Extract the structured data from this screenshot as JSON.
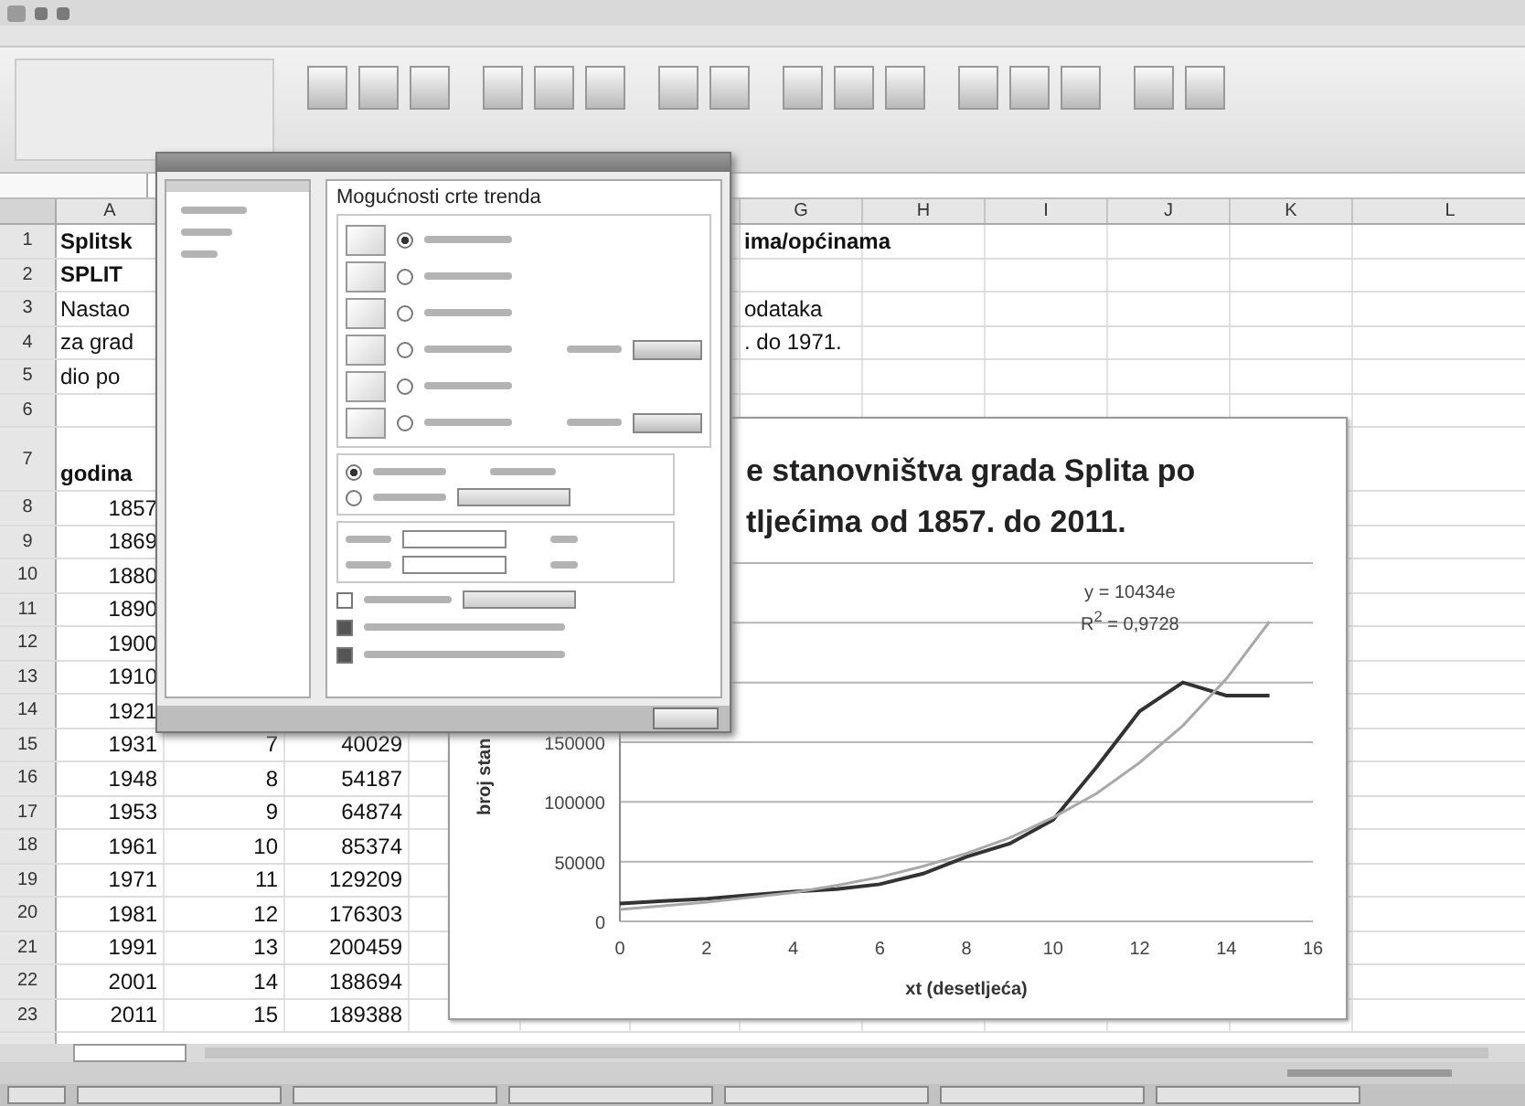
{
  "sheet": {
    "column_headers": [
      "A",
      "G",
      "H",
      "I",
      "J",
      "K",
      "L"
    ],
    "rows": [
      {
        "num": "1",
        "kind": "plain",
        "cells": [
          {
            "text": "Splitsk",
            "bold": true,
            "kind": "text"
          },
          null,
          null,
          null,
          null,
          null,
          {
            "text": "ima/općinama",
            "bold": true,
            "kind": "text"
          }
        ]
      },
      {
        "num": "2",
        "kind": "plain",
        "cells": [
          {
            "text": "SPLIT",
            "bold": true,
            "kind": "text"
          }
        ]
      },
      {
        "num": "3",
        "kind": "plain",
        "cells": [
          {
            "text": "Nastao",
            "bold": false,
            "kind": "text"
          },
          null,
          null,
          null,
          null,
          null,
          {
            "text": "odataka",
            "bold": false,
            "kind": "text"
          }
        ]
      },
      {
        "num": "4",
        "kind": "plain",
        "cells": [
          {
            "text": "za grad",
            "bold": false,
            "kind": "text"
          },
          null,
          null,
          null,
          null,
          null,
          {
            "text": ". do 1971.",
            "bold": false,
            "kind": "text"
          }
        ]
      },
      {
        "num": "5",
        "kind": "plain",
        "cells": [
          {
            "text": "dio po",
            "bold": false,
            "kind": "text"
          }
        ]
      },
      {
        "num": "6",
        "kind": "plain",
        "cells": []
      },
      {
        "num": "7",
        "kind": "tall",
        "cells": [
          {
            "text": "godina",
            "bold": true,
            "kind": "text"
          }
        ]
      },
      {
        "num": "8",
        "kind": "plain",
        "cells": [
          {
            "text": "1857",
            "bold": false,
            "kind": "num"
          }
        ]
      },
      {
        "num": "9",
        "kind": "plain",
        "cells": [
          {
            "text": "1869",
            "bold": false,
            "kind": "num"
          }
        ]
      },
      {
        "num": "10",
        "kind": "plain",
        "cells": [
          {
            "text": "1880",
            "bold": false,
            "kind": "num"
          }
        ]
      },
      {
        "num": "11",
        "kind": "plain",
        "cells": [
          {
            "text": "1890",
            "bold": false,
            "kind": "num"
          }
        ]
      },
      {
        "num": "12",
        "kind": "plain",
        "cells": [
          {
            "text": "1900",
            "bold": false,
            "kind": "num"
          }
        ]
      },
      {
        "num": "13",
        "kind": "plain",
        "cells": [
          {
            "text": "1910",
            "bold": false,
            "kind": "num"
          }
        ]
      },
      {
        "num": "14",
        "kind": "plain",
        "cells": [
          {
            "text": "1921",
            "bold": false,
            "kind": "num"
          }
        ]
      },
      {
        "num": "15",
        "kind": "plain",
        "cells": [
          {
            "text": "1931",
            "bold": false,
            "kind": "num"
          },
          {
            "text": "7",
            "bold": false,
            "kind": "num"
          },
          {
            "text": "40029",
            "bold": false,
            "kind": "num"
          }
        ]
      },
      {
        "num": "16",
        "kind": "plain",
        "cells": [
          {
            "text": "1948",
            "bold": false,
            "kind": "num"
          },
          {
            "text": "8",
            "bold": false,
            "kind": "num"
          },
          {
            "text": "54187",
            "bold": false,
            "kind": "num"
          }
        ]
      },
      {
        "num": "17",
        "kind": "plain",
        "cells": [
          {
            "text": "1953",
            "bold": false,
            "kind": "num"
          },
          {
            "text": "9",
            "bold": false,
            "kind": "num"
          },
          {
            "text": "64874",
            "bold": false,
            "kind": "num"
          }
        ]
      },
      {
        "num": "18",
        "kind": "plain",
        "cells": [
          {
            "text": "1961",
            "bold": false,
            "kind": "num"
          },
          {
            "text": "10",
            "bold": false,
            "kind": "num"
          },
          {
            "text": "85374",
            "bold": false,
            "kind": "num"
          }
        ]
      },
      {
        "num": "19",
        "kind": "plain",
        "cells": [
          {
            "text": "1971",
            "bold": false,
            "kind": "num"
          },
          {
            "text": "11",
            "bold": false,
            "kind": "num"
          },
          {
            "text": "129209",
            "bold": false,
            "kind": "num"
          }
        ]
      },
      {
        "num": "20",
        "kind": "plain",
        "cells": [
          {
            "text": "1981",
            "bold": false,
            "kind": "num"
          },
          {
            "text": "12",
            "bold": false,
            "kind": "num"
          },
          {
            "text": "176303",
            "bold": false,
            "kind": "num"
          }
        ]
      },
      {
        "num": "21",
        "kind": "plain",
        "cells": [
          {
            "text": "1991",
            "bold": false,
            "kind": "num"
          },
          {
            "text": "13",
            "bold": false,
            "kind": "num"
          },
          {
            "text": "200459",
            "bold": false,
            "kind": "num"
          }
        ]
      },
      {
        "num": "22",
        "kind": "plain",
        "cells": [
          {
            "text": "2001",
            "bold": false,
            "kind": "num"
          },
          {
            "text": "14",
            "bold": false,
            "kind": "num"
          },
          {
            "text": "188694",
            "bold": false,
            "kind": "num"
          }
        ]
      },
      {
        "num": "23",
        "kind": "plain",
        "cells": [
          {
            "text": "2011",
            "bold": false,
            "kind": "num"
          },
          {
            "text": "15",
            "bold": false,
            "kind": "num"
          },
          {
            "text": "189388",
            "bold": false,
            "kind": "num"
          }
        ]
      }
    ]
  },
  "chart": {
    "title_lines": [
      "e stanovništva grada Splita po",
      "tljećima od 1857. do 2011."
    ],
    "trend_equation": "y = 10434e",
    "r_squared": "R$^{2}$ = 0,9728",
    "chart_data": {
      "type": "line",
      "xlabel": "xt (desetljeća)",
      "ylabel": "broj stan",
      "x": [
        0,
        1,
        2,
        3,
        4,
        5,
        6,
        7,
        8,
        9,
        10,
        11,
        12,
        13,
        14,
        15
      ],
      "series": [
        {
          "color": "#333333",
          "values": [
            15000,
            17000,
            19000,
            22000,
            25000,
            27000,
            31000,
            40000,
            54000,
            65000,
            85000,
            129000,
            176000,
            200000,
            189000,
            189000
          ]
        },
        {
          "color": "#a8a8a8",
          "values": [
            10000,
            13000,
            16000,
            20000,
            24000,
            30000,
            37000,
            46000,
            57000,
            70000,
            87000,
            107000,
            133000,
            164000,
            203000,
            251000
          ]
        }
      ],
      "grid": true,
      "xlim": [
        0,
        16
      ],
      "ylim": [
        0,
        300000
      ],
      "xticks": [
        0,
        2,
        4,
        6,
        8,
        10,
        12,
        14,
        16
      ],
      "yticks": [
        0,
        50000,
        100000,
        150000
      ]
    }
  },
  "dialog": {
    "title": "Mogućnosti crte trenda",
    "trend_types": [
      {
        "selected": true,
        "kind": "plain"
      },
      {
        "selected": false,
        "kind": "plain"
      },
      {
        "selected": false,
        "kind": "plain"
      },
      {
        "selected": false,
        "kind": "with-field"
      },
      {
        "selected": false,
        "kind": "plain"
      },
      {
        "selected": false,
        "kind": "with-field"
      }
    ],
    "name_options": [
      {
        "selected": true,
        "kind": "plain"
      },
      {
        "selected": false,
        "kind": "with-field"
      }
    ],
    "checkboxes": [
      {
        "checked": false,
        "kind": "with-field"
      },
      {
        "checked": true,
        "kind": "plain"
      },
      {
        "checked": true,
        "kind": "plain"
      }
    ]
  }
}
